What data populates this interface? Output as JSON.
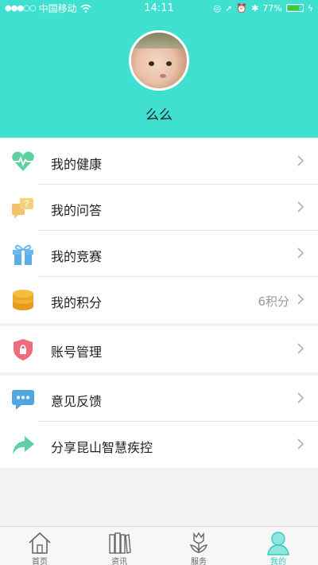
{
  "status_bar": {
    "carrier": "中国移动",
    "time": "14:11",
    "battery_percent": "77%",
    "battery_level": 0.77
  },
  "profile": {
    "username": "么么"
  },
  "menu": {
    "health": "我的健康",
    "qa": "我的问答",
    "competition": "我的竞赛",
    "points": "我的积分",
    "points_value": "6积分",
    "account": "账号管理",
    "feedback": "意见反馈",
    "share": "分享昆山智慧疾控"
  },
  "tabs": {
    "home": "首页",
    "news": "资讯",
    "service": "服务",
    "mine": "我的"
  },
  "colors": {
    "header": "#40e0d0",
    "accent": "#36c9c0"
  }
}
